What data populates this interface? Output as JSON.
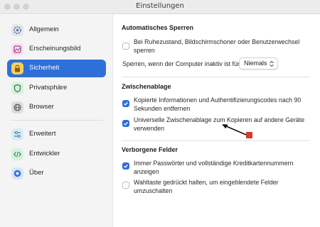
{
  "window": {
    "title": "Einstellungen"
  },
  "sidebar": {
    "items": [
      {
        "label": "Allgemein",
        "icon": "gear-icon"
      },
      {
        "label": "Erscheinungsbild",
        "icon": "appearance-icon"
      },
      {
        "label": "Sicherheit",
        "icon": "lock-icon",
        "active": true
      },
      {
        "label": "Privatsphäre",
        "icon": "shield-icon"
      },
      {
        "label": "Browser",
        "icon": "globe-icon"
      },
      {
        "label": "Erweitert",
        "icon": "sliders-icon"
      },
      {
        "label": "Entwickler",
        "icon": "code-icon"
      },
      {
        "label": "Über",
        "icon": "info-icon"
      }
    ]
  },
  "sections": {
    "auto_lock": {
      "title": "Automatisches Sperren",
      "option_label": "Bei Ruhezustand, Bildschirmschoner oder Benutzerwechsel sperren",
      "option_checked": false,
      "inactive_label": "Sperren, wenn der Computer inaktiv ist für",
      "inactive_value": "Niemals"
    },
    "clipboard": {
      "title": "Zwischenablage",
      "option1_label": "Kopierte Informationen und Authentifizierungscodes nach 90 Sekunden entfernen",
      "option1_checked": true,
      "option2_label": "Universelle Zwischenablage zum Kopieren auf andere Geräte verwenden",
      "option2_checked": true
    },
    "hidden_fields": {
      "title": "Verborgene Felder",
      "option1_label": "Immer Passwörter und vollständige Kreditkartennummern anzeigen",
      "option1_checked": true,
      "option2_label": "Wahltaste gedrückt halten, um eingeblendete Felder umzuschalten",
      "option2_checked": false
    }
  },
  "colors": {
    "accent": "#2f6fd8",
    "annotation_marker": "#d63a2c"
  }
}
